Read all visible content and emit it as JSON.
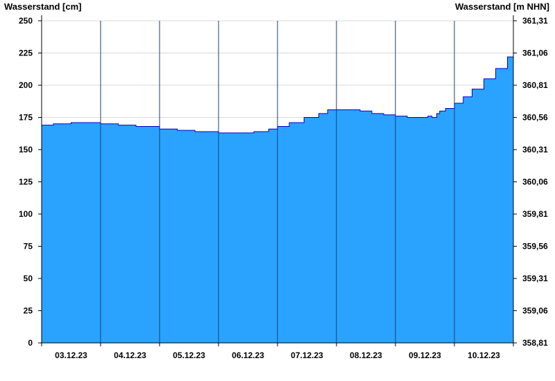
{
  "chart_data": {
    "type": "area",
    "ylabel_left": "Wasserstand [cm]",
    "ylabel_right": "Wasserstand [m NHN]",
    "ylim_left": [
      0,
      250
    ],
    "yticks_left": [
      "0",
      "25",
      "50",
      "75",
      "100",
      "125",
      "150",
      "175",
      "200",
      "225",
      "250"
    ],
    "ylim_right": [
      358.81,
      361.31
    ],
    "yticks_right": [
      "358,81",
      "359,06",
      "359,31",
      "359,56",
      "359,81",
      "360,06",
      "360,31",
      "360,56",
      "360,81",
      "361,06",
      "361,31"
    ],
    "xlim_days": [
      0,
      8
    ],
    "x_tick_labels": [
      "03.12.23",
      "04.12.23",
      "05.12.23",
      "06.12.23",
      "07.12.23",
      "08.12.23",
      "09.12.23",
      "10.12.23"
    ],
    "fill_color": "#29a3ff",
    "line_color": "#0000cc",
    "grid": true,
    "series": [
      {
        "x": [
          0,
          0.2,
          0.5,
          0.75,
          1,
          1.3,
          1.6,
          2,
          2.3,
          2.6,
          3,
          3.3,
          3.6,
          3.85,
          4,
          4.2,
          4.45,
          4.7,
          4.85,
          5,
          5.2,
          5.4,
          5.6,
          5.8,
          6,
          6.2,
          6.4,
          6.55,
          6.62,
          6.7,
          6.75,
          6.85,
          7,
          7.15,
          7.3,
          7.5,
          7.7,
          7.9,
          8
        ],
        "values": [
          169,
          170,
          171,
          171,
          170,
          169,
          168,
          166,
          165,
          164,
          163,
          163,
          164,
          166,
          168,
          171,
          175,
          178,
          181,
          181,
          181,
          180,
          178,
          177,
          176,
          175,
          175,
          176,
          175,
          178,
          180,
          182,
          186,
          191,
          197,
          205,
          213,
          222,
          232
        ]
      }
    ]
  }
}
